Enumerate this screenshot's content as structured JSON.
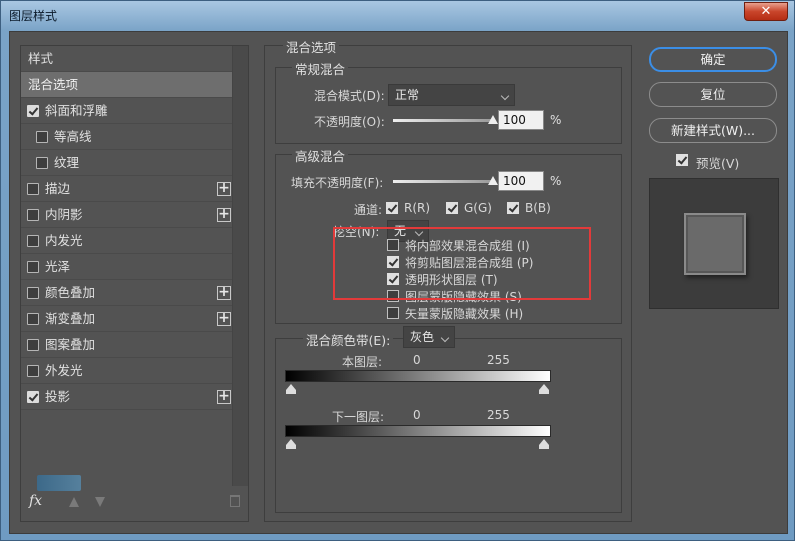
{
  "window": {
    "title": "图层样式",
    "close_label": "✕"
  },
  "left": {
    "items": [
      {
        "label": "样式",
        "kind": "header"
      },
      {
        "label": "混合选项",
        "kind": "selected"
      },
      {
        "label": "斜面和浮雕",
        "checked": true,
        "plus": false
      },
      {
        "label": "等高线",
        "checked": false,
        "sub": true
      },
      {
        "label": "纹理",
        "checked": false,
        "sub": true
      },
      {
        "label": "描边",
        "checked": false,
        "plus": true
      },
      {
        "label": "内阴影",
        "checked": false,
        "plus": true
      },
      {
        "label": "内发光",
        "checked": false
      },
      {
        "label": "光泽",
        "checked": false
      },
      {
        "label": "颜色叠加",
        "checked": false,
        "plus": true
      },
      {
        "label": "渐变叠加",
        "checked": false,
        "plus": true
      },
      {
        "label": "图案叠加",
        "checked": false
      },
      {
        "label": "外发光",
        "checked": false
      },
      {
        "label": "投影",
        "checked": true,
        "plus": true
      }
    ],
    "fx_label": "fx",
    "plus_glyph": "+"
  },
  "blend": {
    "section_title": "混合选项",
    "general_title": "常规混合",
    "mode_label": "混合模式(D):",
    "mode_value": "正常",
    "opacity_label": "不透明度(O):",
    "opacity_value": "100",
    "opacity_fill": 1.0,
    "percent": "%",
    "advanced_title": "高级混合",
    "fill_label": "填充不透明度(F):",
    "fill_value": "100",
    "fill_fill": 1.0,
    "channels_label": "通道:",
    "channels": [
      {
        "label": "R(R)",
        "checked": true
      },
      {
        "label": "G(G)",
        "checked": true
      },
      {
        "label": "B(B)",
        "checked": true
      }
    ],
    "knockout_label": "挖空(N):",
    "knockout_value": "无",
    "options": [
      {
        "label": "将内部效果混合成组 (I)",
        "checked": false
      },
      {
        "label": "将剪贴图层混合成组 (P)",
        "checked": true
      },
      {
        "label": "透明形状图层 (T)",
        "checked": true
      },
      {
        "label": "图层蒙版隐藏效果 (S)",
        "checked": false
      },
      {
        "label": "矢量蒙版隐藏效果 (H)",
        "checked": false
      }
    ],
    "blend_if_label": "混合颜色带(E):",
    "blend_if_value": "灰色",
    "this_layer_label": "本图层:",
    "underlying_label": "下一图层:",
    "range_low": "0",
    "range_high": "255"
  },
  "right": {
    "ok_label": "确定",
    "reset_label": "复位",
    "new_style_label": "新建样式(W)...",
    "preview_label": "预览(V)",
    "preview_checked": true
  }
}
